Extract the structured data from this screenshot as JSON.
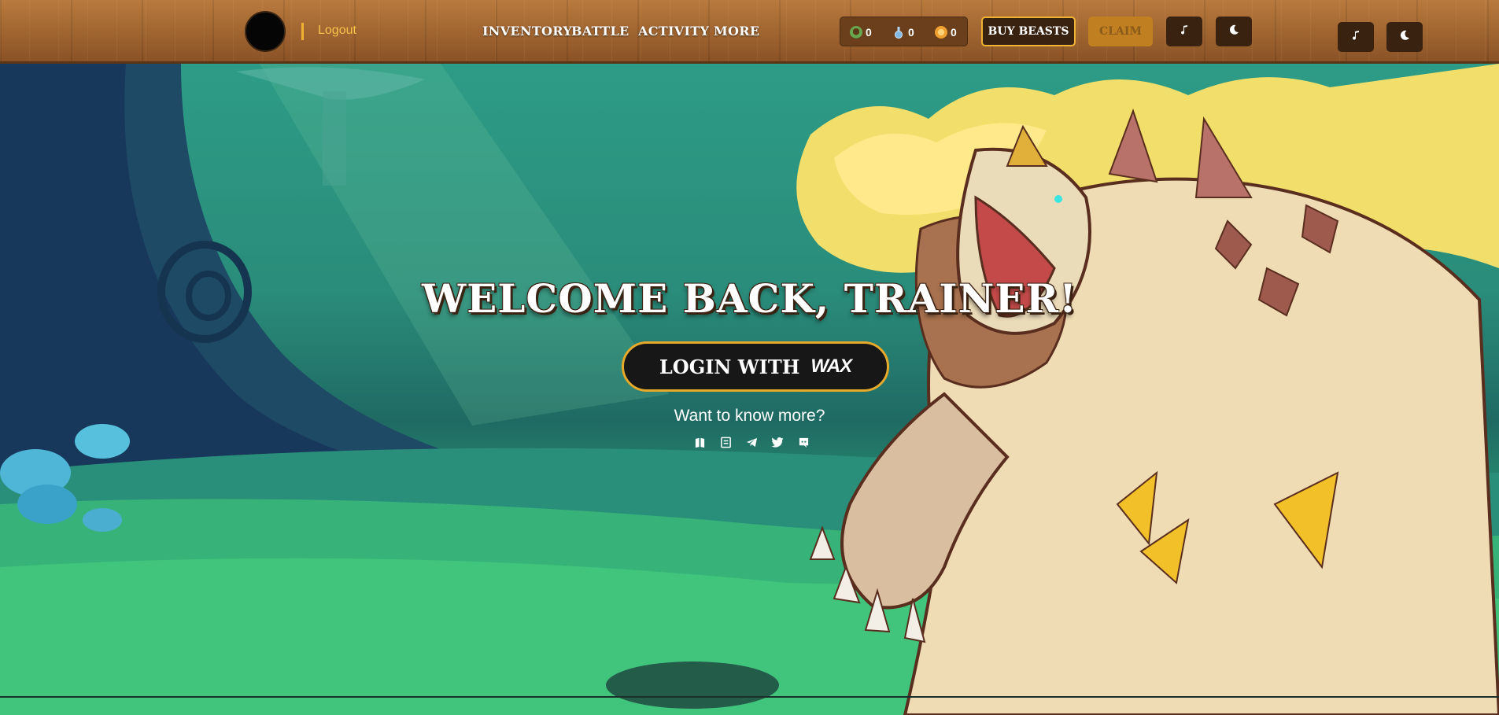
{
  "header": {
    "logout_label": "Logout",
    "nav": [
      "INVENTORY",
      "BATTLE",
      "ACTIVITY",
      "MORE"
    ],
    "resources": [
      {
        "icon": "food-icon",
        "value": "0",
        "color": "#6aa84f"
      },
      {
        "icon": "potion-icon",
        "value": "0",
        "color": "#7fb8e6"
      },
      {
        "icon": "coin-icon",
        "value": "0",
        "color": "#f0a030"
      }
    ],
    "buy_beasts_label": "BUY BEASTS",
    "claim_label": "CLAIM"
  },
  "hero": {
    "title": "WELCOME BACK, TRAINER!",
    "login_label": "LOGIN WITH",
    "wax_logo_text": "WAX",
    "more_text": "Want to know more?",
    "socials": [
      "book-icon",
      "document-icon",
      "telegram-icon",
      "twitter-icon",
      "discord-icon"
    ]
  },
  "colors": {
    "accent": "#f0b233",
    "wood": "#9f6430",
    "dark_button": "#3a2210"
  }
}
